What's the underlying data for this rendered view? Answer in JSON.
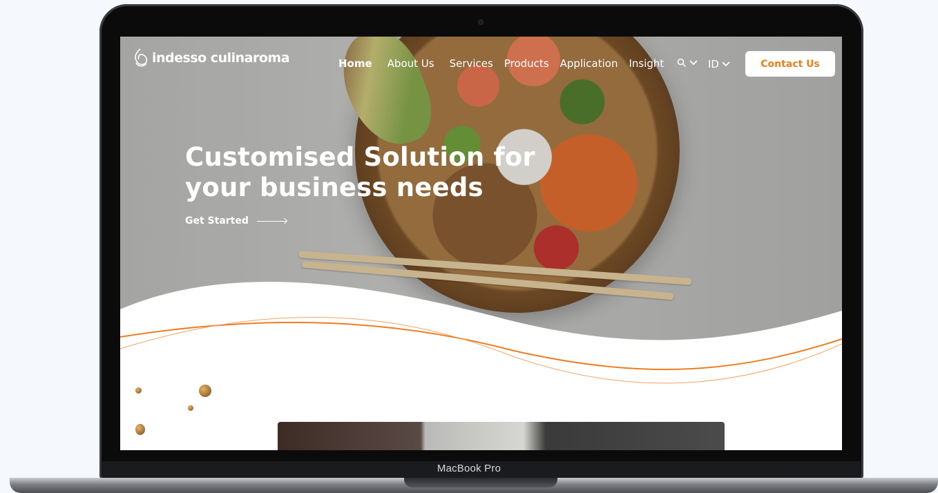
{
  "device": {
    "label": "MacBook Pro"
  },
  "site": {
    "brand": {
      "logo_text": "indesso culinaroma"
    },
    "nav": {
      "items": [
        {
          "label": "Home",
          "active": true
        },
        {
          "label": "About Us",
          "active": false
        },
        {
          "label": "Services",
          "active": false
        },
        {
          "label": "Products",
          "active": false
        },
        {
          "label": "Application",
          "active": false
        },
        {
          "label": "Insight",
          "active": false
        }
      ],
      "search_icon": "search-icon",
      "language": "ID",
      "contact_label": "Contact Us"
    },
    "hero": {
      "headline_line1": "Customised Solution for",
      "headline_line2": "your business needs",
      "cta_label": "Get Started"
    }
  },
  "colors": {
    "accent": "#ee7d21",
    "white": "#ffffff",
    "laptop_frame": "#0b0b0c"
  }
}
